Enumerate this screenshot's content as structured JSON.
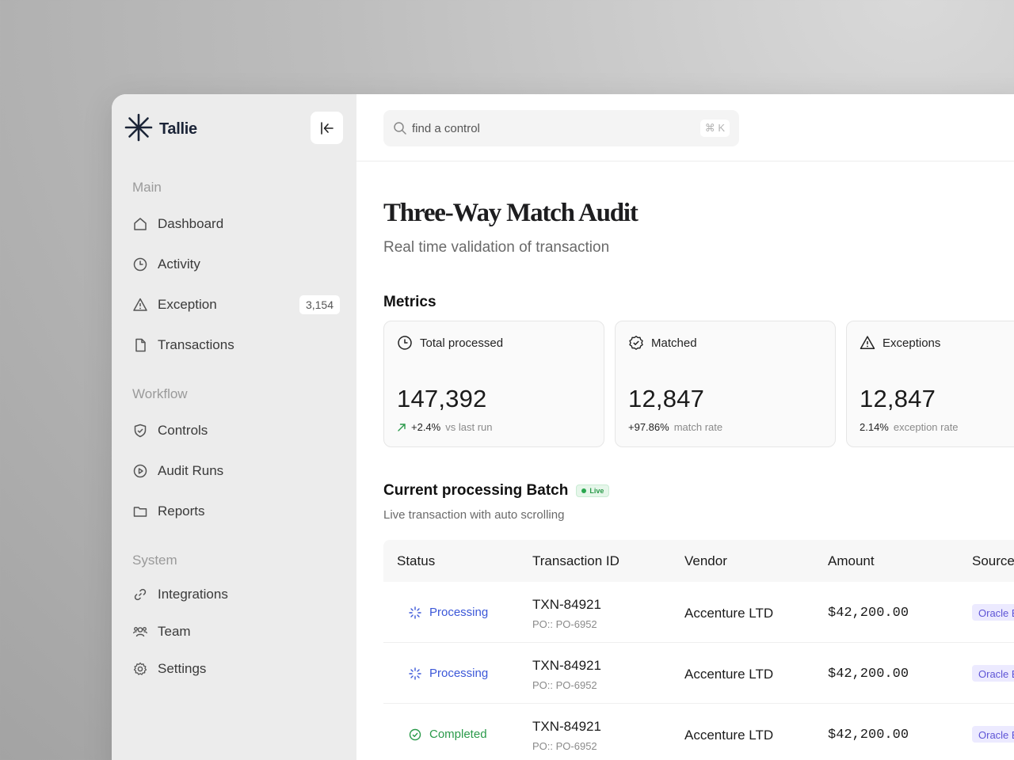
{
  "brand": {
    "name": "Tallie"
  },
  "search": {
    "placeholder": "find a control",
    "shortcut": "⌘ K"
  },
  "sidebar": {
    "sections": [
      {
        "title": "Main",
        "items": [
          {
            "label": "Dashboard",
            "icon": "home-icon"
          },
          {
            "label": "Activity",
            "icon": "clock-icon"
          },
          {
            "label": "Exception",
            "icon": "warning-icon",
            "badge": "3,154"
          },
          {
            "label": "Transactions",
            "icon": "file-icon"
          }
        ]
      },
      {
        "title": "Workflow",
        "items": [
          {
            "label": "Controls",
            "icon": "shield-icon"
          },
          {
            "label": "Audit Runs",
            "icon": "play-icon"
          },
          {
            "label": "Reports",
            "icon": "folder-icon"
          }
        ]
      },
      {
        "title": "System",
        "items": [
          {
            "label": "Integrations",
            "icon": "link-icon"
          },
          {
            "label": "Team",
            "icon": "users-icon"
          },
          {
            "label": "Settings",
            "icon": "gear-icon"
          }
        ]
      }
    ]
  },
  "page": {
    "title": "Three-Way Match Audit",
    "subtitle": "Real time validation of transaction"
  },
  "metrics": {
    "title": "Metrics",
    "cards": [
      {
        "label": "Total processed",
        "icon": "clock-icon",
        "value": "147,392",
        "delta": "+2.4%",
        "note": "vs last run"
      },
      {
        "label": "Matched",
        "icon": "badge-check-icon",
        "value": "12,847",
        "delta": "+97.86%",
        "note": "match rate"
      },
      {
        "label": "Exceptions",
        "icon": "warning-icon",
        "value": "12,847",
        "delta": "2.14%",
        "note": "exception rate"
      }
    ]
  },
  "batch": {
    "title": "Current processing Batch",
    "live_label": "Live",
    "subtitle": "Live transaction with auto scrolling",
    "columns": [
      "Status",
      "Transaction ID",
      "Vendor",
      "Amount",
      "Source"
    ],
    "rows": [
      {
        "status": "Processing",
        "txn": "TXN-84921",
        "po": "PO:: PO-6952",
        "vendor": "Accenture LTD",
        "amount": "$42,200.00",
        "source": "Oracle ERP"
      },
      {
        "status": "Processing",
        "txn": "TXN-84921",
        "po": "PO:: PO-6952",
        "vendor": "Accenture LTD",
        "amount": "$42,200.00",
        "source": "Oracle ERP"
      },
      {
        "status": "Completed",
        "txn": "TXN-84921",
        "po": "PO:: PO-6952",
        "vendor": "Accenture LTD",
        "amount": "$42,200.00",
        "source": "Oracle ERP"
      }
    ]
  },
  "colors": {
    "processing": "#3b57d8",
    "completed": "#2a9a4a",
    "accent": "#5f55d6"
  }
}
